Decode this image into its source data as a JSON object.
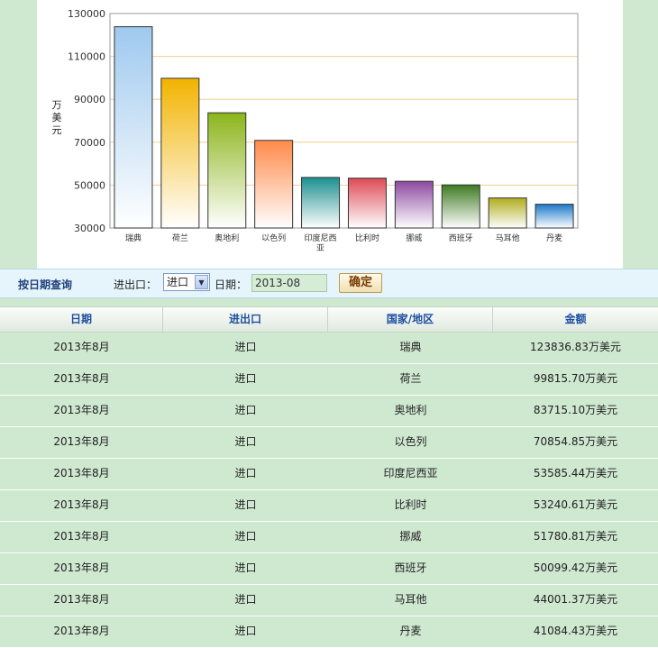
{
  "chart_data": {
    "type": "bar",
    "categories": [
      "瑞典",
      "荷兰",
      "奥地利",
      "以色列",
      "印度尼西亚",
      "比利时",
      "挪威",
      "西班牙",
      "马耳他",
      "丹麦"
    ],
    "values": [
      123836.83,
      99815.7,
      83715.1,
      70854.85,
      53585.44,
      53240.61,
      51780.81,
      50099.42,
      44001.37,
      41084.43
    ],
    "ylabel": "万美元",
    "ylim": [
      30000,
      130000
    ],
    "yticks": [
      30000,
      50000,
      70000,
      90000,
      110000,
      130000
    ],
    "grid": true,
    "bar_colors": [
      [
        "#9ec9ee",
        "#ffffff"
      ],
      [
        "#f2b300",
        "#ffffff"
      ],
      [
        "#8bb51a",
        "#ffffff"
      ],
      [
        "#ff8a4a",
        "#ffffff"
      ],
      [
        "#1c8f8f",
        "#ffffff"
      ],
      [
        "#dd4a55",
        "#ffffff"
      ],
      [
        "#8d4aa0",
        "#ffffff"
      ],
      [
        "#3f7a22",
        "#ffffff"
      ],
      [
        "#b0ad1e",
        "#ffffff"
      ],
      [
        "#1a78c9",
        "#ffffff"
      ]
    ],
    "x_label_lines": [
      [
        "瑞典"
      ],
      [
        "荷兰"
      ],
      [
        "奥地利"
      ],
      [
        "以色列"
      ],
      [
        "印度尼西",
        "亚"
      ],
      [
        "比利时"
      ],
      [
        "挪威"
      ],
      [
        "西班牙"
      ],
      [
        "马耳他"
      ],
      [
        "丹麦"
      ]
    ]
  },
  "query": {
    "title": "按日期查询",
    "io_label": "进出口：",
    "io_value": "进口",
    "date_label": "日期：",
    "date_value": "2013-08",
    "confirm_label": "确定"
  },
  "table": {
    "headers": [
      "日期",
      "进出口",
      "国家/地区",
      "金额"
    ],
    "rows": [
      [
        "2013年8月",
        "进口",
        "瑞典",
        "123836.83万美元"
      ],
      [
        "2013年8月",
        "进口",
        "荷兰",
        "99815.70万美元"
      ],
      [
        "2013年8月",
        "进口",
        "奥地利",
        "83715.10万美元"
      ],
      [
        "2013年8月",
        "进口",
        "以色列",
        "70854.85万美元"
      ],
      [
        "2013年8月",
        "进口",
        "印度尼西亚",
        "53585.44万美元"
      ],
      [
        "2013年8月",
        "进口",
        "比利时",
        "53240.61万美元"
      ],
      [
        "2013年8月",
        "进口",
        "挪威",
        "51780.81万美元"
      ],
      [
        "2013年8月",
        "进口",
        "西班牙",
        "50099.42万美元"
      ],
      [
        "2013年8月",
        "进口",
        "马耳他",
        "44001.37万美元"
      ],
      [
        "2013年8月",
        "进口",
        "丹麦",
        "41084.43万美元"
      ]
    ]
  },
  "icons": {
    "dropdown": "chevron-down-icon"
  }
}
